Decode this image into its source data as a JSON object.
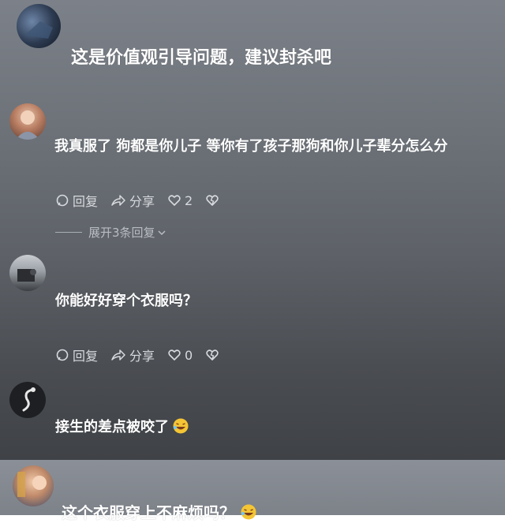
{
  "comments": [
    {
      "text": "这是价值观引导问题，建议封杀吧"
    },
    {
      "text": "我真服了 狗都是你儿子 等你有了孩子那狗和你儿子辈分怎么分",
      "actions": {
        "reply": "回复",
        "share": "分享",
        "likes": "2"
      },
      "expand": "展开3条回复"
    },
    {
      "text": "你能好好穿个衣服吗？",
      "actions": {
        "reply": "回复",
        "share": "分享",
        "likes": "0"
      }
    },
    {
      "text": "接生的差点被咬了"
    },
    {
      "text": "这个衣服穿上不麻烦吗？"
    }
  ],
  "colors": {
    "text": "#ffffff",
    "muted": "#d7dade"
  },
  "icons": [
    "reply-bubble-icon",
    "share-icon",
    "heart-icon",
    "dislike-heart-icon",
    "laughing-emoji-icon",
    "chevron-down-icon"
  ]
}
